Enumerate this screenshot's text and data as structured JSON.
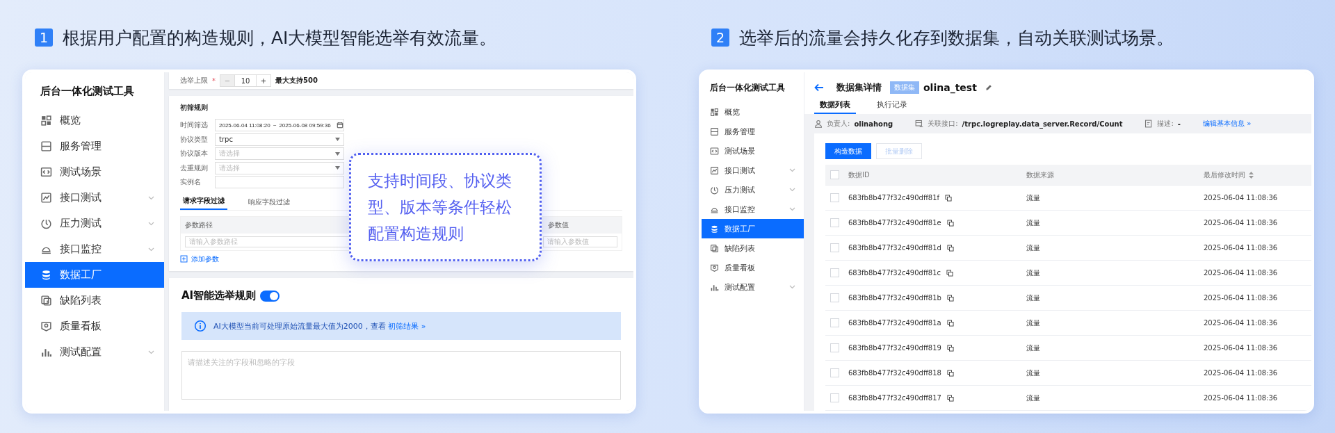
{
  "captions": [
    {
      "number": "1",
      "text": "根据用户配置的构造规则，AI大模型智能选举有效流量。"
    },
    {
      "number": "2",
      "text": "选举后的流量会持久化存到数据集，自动关联测试场景。"
    }
  ],
  "left_screen": {
    "sidebar": {
      "title": "后台一体化测试工具",
      "items": [
        {
          "label": "概览",
          "selected": false,
          "has_submenu": false
        },
        {
          "label": "服务管理",
          "selected": false,
          "has_submenu": false
        },
        {
          "label": "测试场景",
          "selected": false,
          "has_submenu": false
        },
        {
          "label": "接口测试",
          "selected": false,
          "has_submenu": true
        },
        {
          "label": "压力测试",
          "selected": false,
          "has_submenu": true
        },
        {
          "label": "接口监控",
          "selected": false,
          "has_submenu": true
        },
        {
          "label": "数据工厂",
          "selected": true,
          "has_submenu": false
        },
        {
          "label": "缺陷列表",
          "selected": false,
          "has_submenu": false
        },
        {
          "label": "质量看板",
          "selected": false,
          "has_submenu": false
        },
        {
          "label": "测试配置",
          "selected": false,
          "has_submenu": true
        }
      ]
    },
    "election_limit": {
      "label": "选举上限",
      "required_mark": "*",
      "minus": "−",
      "value": "10",
      "plus": "+",
      "hint": "最大支持500"
    },
    "filter_rules": {
      "title": "初筛规则",
      "fields": [
        {
          "label": "时间筛选",
          "kind": "daterange",
          "start": "2025-06-04 11:08:20",
          "separator": "~",
          "end": "2025-06-08 09:59:36"
        },
        {
          "label": "协议类型",
          "kind": "select",
          "value": "trpc"
        },
        {
          "label": "协议版本",
          "kind": "select",
          "placeholder": "请选择"
        },
        {
          "label": "去重规则",
          "kind": "select",
          "placeholder": "请选择"
        },
        {
          "label": "实例名",
          "kind": "text"
        }
      ],
      "tabs": [
        {
          "label": "请求字段过滤",
          "selected": true
        },
        {
          "label": "响应字段过滤",
          "selected": false
        }
      ],
      "param_columns": [
        "参数路径",
        "参数值"
      ],
      "param_row": {
        "path_placeholder": "请输入参数路径",
        "value_placeholder": "请输入参数值"
      },
      "add_link": "添加参数"
    },
    "ai_rule": {
      "title": "AI智能选举规则",
      "on": true,
      "notice": "AI大模型当前可处理原始流量最大值为2000，查看",
      "notice_link": "初筛结果 »",
      "placeholder": "请描述关注的字段和忽略的字段"
    },
    "callout": "支持时间段、协议类型、版本等条件轻松配置构造规则"
  },
  "right_screen": {
    "sidebar": {
      "title": "后台一体化测试工具",
      "items": [
        {
          "label": "概览",
          "selected": false,
          "has_submenu": false
        },
        {
          "label": "服务管理",
          "selected": false,
          "has_submenu": false
        },
        {
          "label": "测试场景",
          "selected": false,
          "has_submenu": false
        },
        {
          "label": "接口测试",
          "selected": false,
          "has_submenu": true
        },
        {
          "label": "压力测试",
          "selected": false,
          "has_submenu": true
        },
        {
          "label": "接口监控",
          "selected": false,
          "has_submenu": true
        },
        {
          "label": "数据工厂",
          "selected": true,
          "has_submenu": false
        },
        {
          "label": "缺陷列表",
          "selected": false,
          "has_submenu": false
        },
        {
          "label": "质量看板",
          "selected": false,
          "has_submenu": false
        },
        {
          "label": "测试配置",
          "selected": false,
          "has_submenu": true
        }
      ]
    },
    "header": {
      "title": "数据集详情",
      "tag": "数据集",
      "name": "olina_test"
    },
    "tabs": [
      {
        "label": "数据列表",
        "selected": true
      },
      {
        "label": "执行记录",
        "selected": false
      }
    ],
    "info": {
      "owner_label": "负责人:",
      "owner": "olinahong",
      "api_label": "关联接口:",
      "api": "/trpc.logreplay.data_server.Record/Count",
      "desc_label": "描述:",
      "desc": "-",
      "edit_link": "编辑基本信息 »"
    },
    "buttons": [
      {
        "label": "构造数据",
        "disabled": false
      },
      {
        "label": "批量删除",
        "disabled": true
      }
    ],
    "table": {
      "header_checked": false,
      "columns": [
        {
          "label": "数据ID",
          "sortable": false
        },
        {
          "label": "数据来源",
          "sortable": false
        },
        {
          "label": "最后修改时间",
          "sortable": true
        }
      ],
      "rows": [
        {
          "checked": false,
          "id": "683fb8b477f32c490dff81f",
          "source": "流量",
          "time": "2025-06-04 11:08:36"
        },
        {
          "checked": false,
          "id": "683fb8b477f32c490dff81e",
          "source": "流量",
          "time": "2025-06-04 11:08:36"
        },
        {
          "checked": false,
          "id": "683fb8b477f32c490dff81d",
          "source": "流量",
          "time": "2025-06-04 11:08:36"
        },
        {
          "checked": false,
          "id": "683fb8b477f32c490dff81c",
          "source": "流量",
          "time": "2025-06-04 11:08:36"
        },
        {
          "checked": false,
          "id": "683fb8b477f32c490dff81b",
          "source": "流量",
          "time": "2025-06-04 11:08:36"
        },
        {
          "checked": false,
          "id": "683fb8b477f32c490dff81a",
          "source": "流量",
          "time": "2025-06-04 11:08:36"
        },
        {
          "checked": false,
          "id": "683fb8b477f32c490dff819",
          "source": "流量",
          "time": "2025-06-04 11:08:36"
        },
        {
          "checked": false,
          "id": "683fb8b477f32c490dff818",
          "source": "流量",
          "time": "2025-06-04 11:08:36"
        },
        {
          "checked": false,
          "id": "683fb8b477f32c490dff817",
          "source": "流量",
          "time": "2025-06-04 11:08:36"
        }
      ]
    }
  }
}
